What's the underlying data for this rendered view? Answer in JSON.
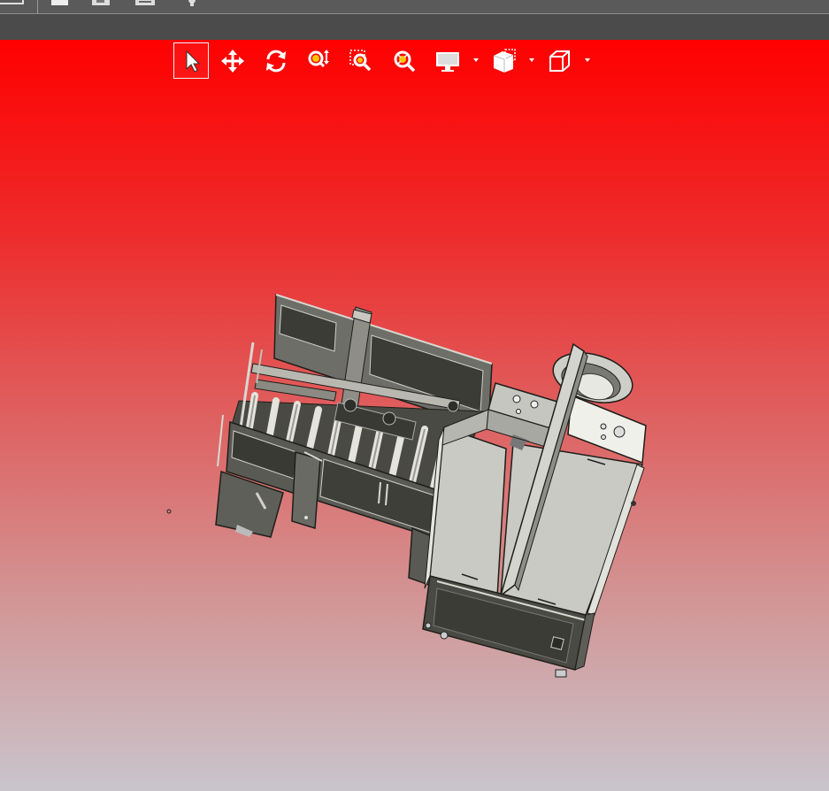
{
  "app_toolbar": {
    "icons": [
      "window-icon",
      "open-folder-icon",
      "save-icon",
      "print-icon",
      "settings-icon"
    ]
  },
  "view_toolbar": {
    "tools": [
      {
        "name": "select-tool",
        "icon": "cursor-arrow-icon",
        "active": true
      },
      {
        "name": "pan-tool",
        "icon": "move-arrows-icon",
        "active": false
      },
      {
        "name": "rotate-tool",
        "icon": "rotate-icon",
        "active": false
      },
      {
        "name": "zoom-tool",
        "icon": "zoom-vertical-icon",
        "active": false
      },
      {
        "name": "zoom-window-tool",
        "icon": "zoom-window-icon",
        "active": false
      },
      {
        "name": "zoom-fit-tool",
        "icon": "zoom-fit-icon",
        "active": false
      },
      {
        "name": "display-mode-dropdown",
        "icon": "monitor-icon",
        "has_dropdown": true
      },
      {
        "name": "section-view-dropdown",
        "icon": "section-view-icon",
        "has_dropdown": true
      },
      {
        "name": "standard-views-dropdown",
        "icon": "cube-view-icon",
        "has_dropdown": true
      }
    ]
  },
  "viewport": {
    "background_top": "#ff0000",
    "background_bottom": "#c9c4cc",
    "model_color": "#c7c7c1",
    "model_dark": "#4a4a44"
  }
}
